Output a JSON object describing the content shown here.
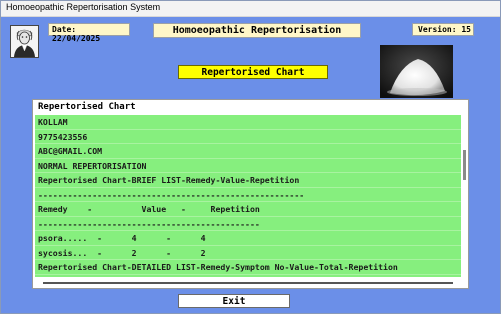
{
  "window": {
    "title": "Homoeopathic Repertorisation System"
  },
  "header": {
    "date": "Date: 22/04/2025",
    "title": "Homoeopathic Repertorisation",
    "version": "Version: 15"
  },
  "chart_title": "Repertorised Chart",
  "panel": {
    "header": "Repertorised Chart",
    "rows": [
      "KOLLAM",
      "9775423556",
      "ABC@GMAIL.COM",
      "NORMAL REPERTORISATION",
      "Repertorised Chart-BRIEF LIST-Remedy-Value-Repetition",
      "------------------------------------------------------",
      "Remedy    -          Value   -     Repetition",
      "---------------------------------------------",
      "psora.....  -      4      -      4",
      "sycosis...  -      2      -      2",
      "Repertorised Chart-DETAILED LIST-Remedy-Symptom No-Value-Total-Repetition"
    ]
  },
  "buttons": {
    "exit": "Exit"
  },
  "icons": {
    "avatar": "doctor-portrait-icon",
    "image": "white-powder-photo"
  },
  "colors": {
    "background": "#6b8fe8",
    "list_bg": "#86ef7e",
    "highlight": "#ffff00",
    "field_bg": "#fff7c8"
  }
}
